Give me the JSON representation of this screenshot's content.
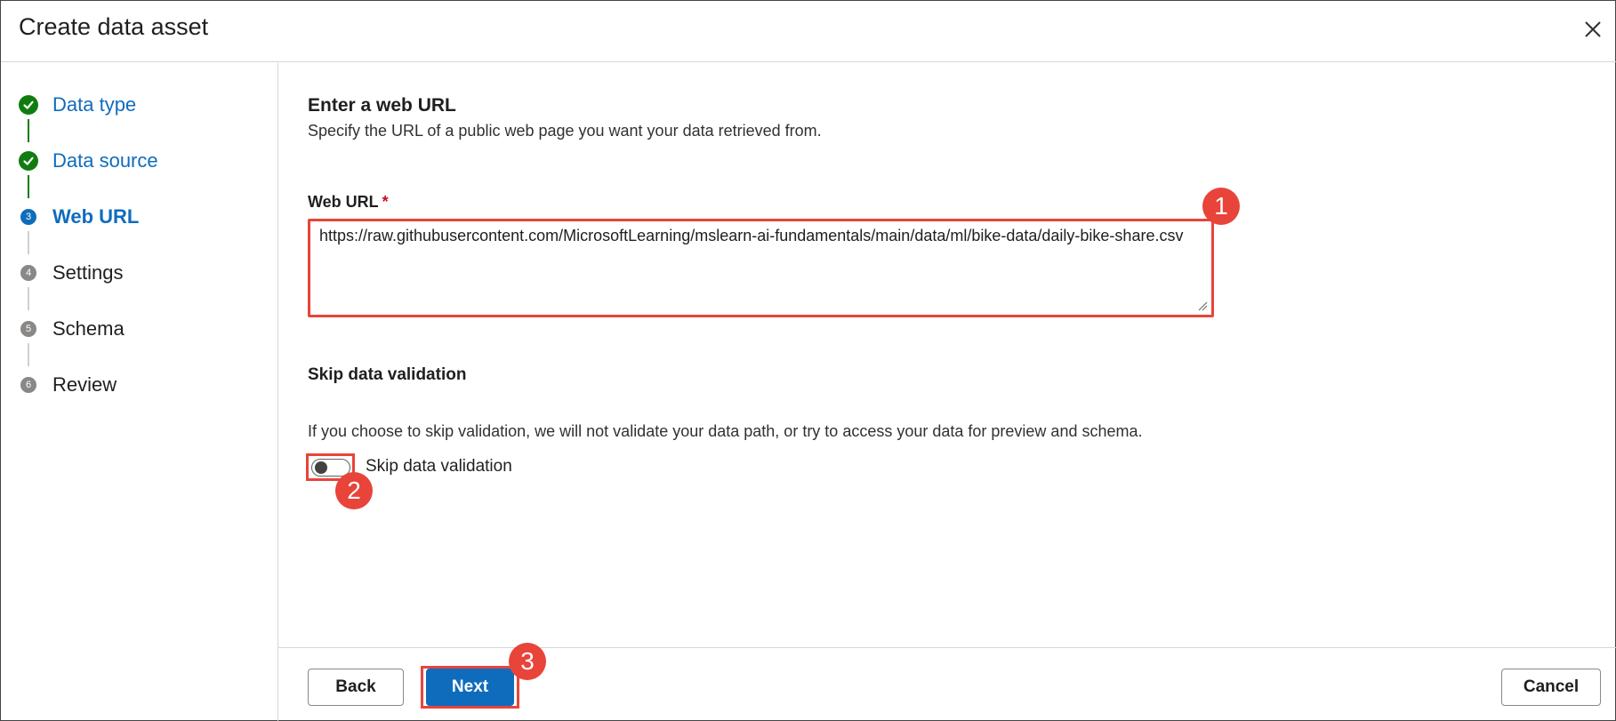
{
  "header": {
    "title": "Create data asset",
    "close_icon": "close-icon"
  },
  "steps": [
    {
      "number": "1",
      "label": "Data type",
      "state": "done"
    },
    {
      "number": "2",
      "label": "Data source",
      "state": "done"
    },
    {
      "number": "3",
      "label": "Web URL",
      "state": "current"
    },
    {
      "number": "4",
      "label": "Settings",
      "state": "todo"
    },
    {
      "number": "5",
      "label": "Schema",
      "state": "todo"
    },
    {
      "number": "6",
      "label": "Review",
      "state": "todo"
    }
  ],
  "main": {
    "section_title": "Enter a web URL",
    "section_desc": "Specify the URL of a public web page you want your data retrieved from.",
    "web_url_label": "Web URL",
    "required_mark": "*",
    "web_url_value": "https://raw.githubusercontent.com/MicrosoftLearning/mslearn-ai-fundamentals/main/data/ml/bike-data/daily-bike-share.csv",
    "skip_title": "Skip data validation",
    "skip_desc": "If you choose to skip validation, we will not validate your data path, or try to access your data for preview and schema.",
    "skip_toggle_label": "Skip data validation",
    "skip_toggle_on": false
  },
  "annotations": {
    "badge_1": "1",
    "badge_2": "2",
    "badge_3": "3"
  },
  "footer": {
    "back_label": "Back",
    "next_label": "Next",
    "cancel_label": "Cancel"
  },
  "colors": {
    "accent": "#0f6cbd",
    "done": "#107c10",
    "highlight": "#e8443a"
  }
}
